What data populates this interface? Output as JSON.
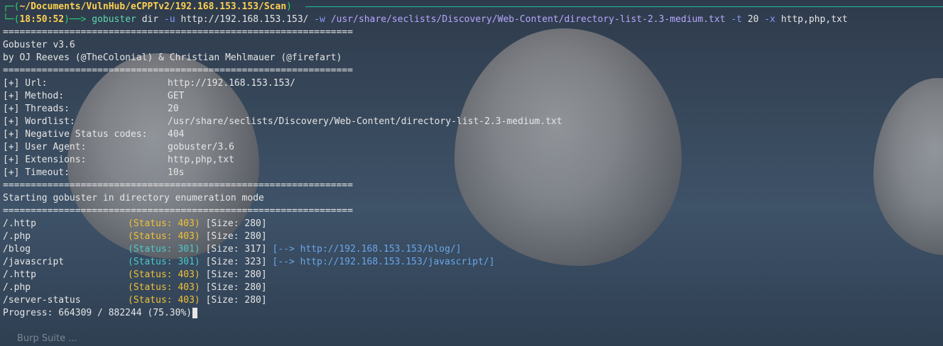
{
  "prompt": {
    "path": "~/Documents/VulnHub/eCPPTv2/192.168.153.153/Scan",
    "time": "18:50:52",
    "command": "gobuster",
    "subcommand": "dir",
    "flag_u": "-u",
    "url_arg": "http://192.168.153.153/",
    "flag_w": "-w",
    "wordlist_arg": "/usr/share/seclists/Discovery/Web-Content/directory-list-2.3-medium.txt",
    "flag_t": "-t",
    "threads_arg": "20",
    "flag_x": "-x",
    "ext_arg": "http,php,txt"
  },
  "banner": {
    "rule": "===============================================================",
    "name": "Gobuster v3.6",
    "credits": "by OJ Reeves (@TheColonial) & Christian Mehlmauer (@firefart)"
  },
  "config": [
    {
      "key": "[+] Url:",
      "value": "http://192.168.153.153/"
    },
    {
      "key": "[+] Method:",
      "value": "GET"
    },
    {
      "key": "[+] Threads:",
      "value": "20"
    },
    {
      "key": "[+] Wordlist:",
      "value": "/usr/share/seclists/Discovery/Web-Content/directory-list-2.3-medium.txt"
    },
    {
      "key": "[+] Negative Status codes:",
      "value": "404"
    },
    {
      "key": "[+] User Agent:",
      "value": "gobuster/3.6"
    },
    {
      "key": "[+] Extensions:",
      "value": "http,php,txt"
    },
    {
      "key": "[+] Timeout:",
      "value": "10s"
    }
  ],
  "start_msg": "Starting gobuster in directory enumeration mode",
  "results": [
    {
      "path": "/.http",
      "status": "(Status: 403)",
      "size": "[Size: 280]",
      "redirect": ""
    },
    {
      "path": "/.php",
      "status": "(Status: 403)",
      "size": "[Size: 280]",
      "redirect": ""
    },
    {
      "path": "/blog",
      "status": "(Status: 301)",
      "size": "[Size: 317]",
      "redirect": "[--> http://192.168.153.153/blog/]"
    },
    {
      "path": "/javascript",
      "status": "(Status: 301)",
      "size": "[Size: 323]",
      "redirect": "[--> http://192.168.153.153/javascript/]"
    },
    {
      "path": "/.http",
      "status": "(Status: 403)",
      "size": "[Size: 280]",
      "redirect": ""
    },
    {
      "path": "/.php",
      "status": "(Status: 403)",
      "size": "[Size: 280]",
      "redirect": ""
    },
    {
      "path": "/server-status",
      "status": "(Status: 403)",
      "size": "[Size: 280]",
      "redirect": ""
    }
  ],
  "progress": "Progress: 664309 / 882244 (75.30%)",
  "desktop": {
    "burp_label": "Burp Suite ..."
  }
}
